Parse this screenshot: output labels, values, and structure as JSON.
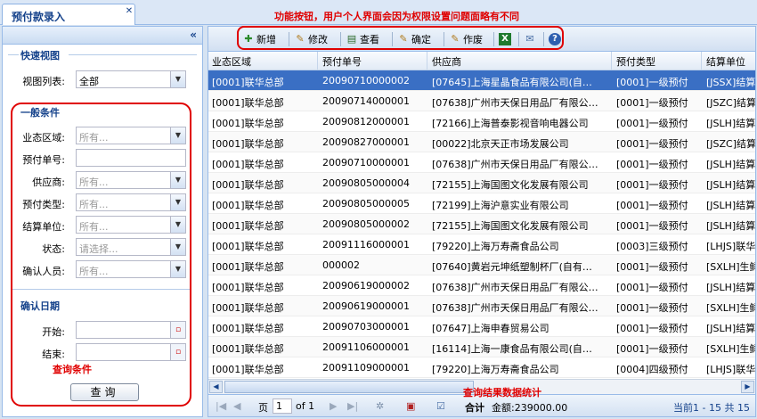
{
  "tab": {
    "title": "预付款录入",
    "close": "✕"
  },
  "annotations": {
    "toolbar_note": "功能按钮，用户个人界面会因为权限设置问题面略有不同",
    "query_note": "查询条件",
    "result_note": "查询结果数据统计"
  },
  "left": {
    "collapse": "«",
    "quick_view": {
      "title": "快速视图",
      "view_label": "视图列表:",
      "view_value": "全部"
    },
    "general": {
      "title": "一般条件",
      "fields": [
        {
          "label": "业态区域:",
          "value": "所有...",
          "type": "combo"
        },
        {
          "label": "预付单号:",
          "value": "",
          "type": "text"
        },
        {
          "label": "供应商:",
          "value": "所有...",
          "type": "combo"
        },
        {
          "label": "预付类型:",
          "value": "所有...",
          "type": "combo"
        },
        {
          "label": "结算单位:",
          "value": "所有...",
          "type": "combo"
        },
        {
          "label": "状态:",
          "value": "请选择...",
          "type": "combo"
        },
        {
          "label": "确认人员:",
          "value": "所有...",
          "type": "combo"
        }
      ]
    },
    "confirm_date": {
      "title": "确认日期",
      "start_label": "开始:",
      "end_label": "结束:"
    },
    "query_button": "查询"
  },
  "toolbar": {
    "buttons": [
      {
        "label": "新增",
        "icon": "add-icon"
      },
      {
        "label": "修改",
        "icon": "edit-icon"
      },
      {
        "label": "查看",
        "icon": "view-icon"
      },
      {
        "label": "确定",
        "icon": "confirm-icon"
      },
      {
        "label": "作废",
        "icon": "void-icon"
      },
      {
        "label": "",
        "icon": "excel-icon"
      },
      {
        "label": "",
        "icon": "mail-icon"
      },
      {
        "label": "",
        "icon": "help-icon"
      }
    ]
  },
  "grid": {
    "columns": [
      "业态区域",
      "预付单号",
      "供应商",
      "预付类型",
      "结算单位"
    ],
    "rows": [
      [
        "[0001]联华总部",
        "20090710000002",
        "[07645]上海星晶食品有限公司(自…",
        "[0001]一级预付",
        "[JSSX]结算"
      ],
      [
        "[0001]联华总部",
        "20090714000001",
        "[07638]广州市天保日用品厂有限公…",
        "[0001]一级预付",
        "[JSZC]结算"
      ],
      [
        "[0001]联华总部",
        "20090812000001",
        "[72166]上海普泰影视音响电器公司",
        "[0001]一级预付",
        "[JSLH]结算"
      ],
      [
        "[0001]联华总部",
        "20090827000001",
        "[00022]北京天正市场发展公司",
        "[0001]一级预付",
        "[JSZC]结算"
      ],
      [
        "[0001]联华总部",
        "20090710000001",
        "[07638]广州市天保日用品厂有限公…",
        "[0001]一级预付",
        "[JSLH]结算"
      ],
      [
        "[0001]联华总部",
        "20090805000004",
        "[72155]上海国图文化发展有限公司",
        "[0001]一级预付",
        "[JSLH]结算"
      ],
      [
        "[0001]联华总部",
        "20090805000005",
        "[72199]上海沪意实业有限公司",
        "[0001]一级预付",
        "[JSLH]结算"
      ],
      [
        "[0001]联华总部",
        "20090805000002",
        "[72155]上海国图文化发展有限公司",
        "[0001]一级预付",
        "[JSLH]结算"
      ],
      [
        "[0001]联华总部",
        "20091116000001",
        "[79220]上海万寿斋食品公司",
        "[0003]三级预付",
        "[LHJS]联华"
      ],
      [
        "[0001]联华总部",
        "000002",
        "[07640]黄岩元坤纸塑制杯厂(自有…",
        "[0001]一级预付",
        "[SXLH]生鲜"
      ],
      [
        "[0001]联华总部",
        "20090619000002",
        "[07638]广州市天保日用品厂有限公…",
        "[0001]一级预付",
        "[JSLH]结算"
      ],
      [
        "[0001]联华总部",
        "20090619000001",
        "[07638]广州市天保日用品厂有限公…",
        "[0001]一级预付",
        "[SXLH]生鲜"
      ],
      [
        "[0001]联华总部",
        "20090703000001",
        "[07647]上海申春贸易公司",
        "[0001]一级预付",
        "[JSLH]结算"
      ],
      [
        "[0001]联华总部",
        "20091106000001",
        "[16114]上海一康食品有限公司(自…",
        "[0001]一级预付",
        "[SXLH]生鲜"
      ],
      [
        "[0001]联华总部",
        "20091109000001",
        "[79220]上海万寿斋食品公司",
        "[0004]四级预付",
        "[LHJS]联华"
      ]
    ]
  },
  "pager": {
    "page_label": "页",
    "page_value": "1",
    "of_label": "of 1",
    "sum_label": "合计",
    "amount": "金额:239000.00",
    "status": "当前1 - 15 共 15"
  }
}
